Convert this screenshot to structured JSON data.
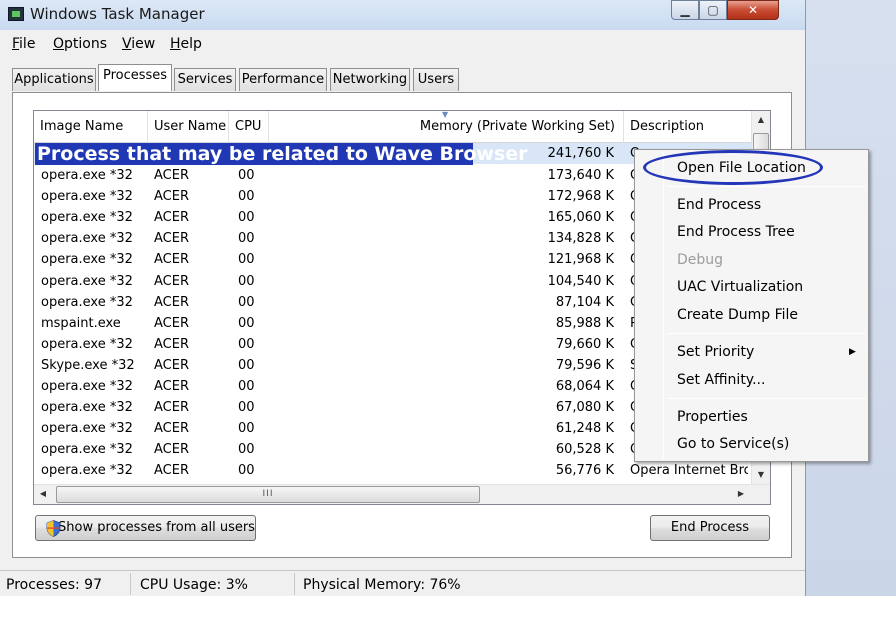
{
  "window": {
    "title": "Windows Task Manager",
    "controls": {
      "minimize": "▁",
      "maximize": "▢",
      "close": "✕"
    }
  },
  "menubar": [
    {
      "label": "File",
      "mnemonic": "F",
      "rest": "ile"
    },
    {
      "label": "Options",
      "mnemonic": "O",
      "rest": "ptions"
    },
    {
      "label": "View",
      "mnemonic": "V",
      "rest": "iew"
    },
    {
      "label": "Help",
      "mnemonic": "H",
      "rest": "elp"
    }
  ],
  "tabs": [
    "Applications",
    "Processes",
    "Services",
    "Performance",
    "Networking",
    "Users"
  ],
  "active_tab": "Processes",
  "columns": [
    "Image Name",
    "User Name",
    "CPU",
    "Memory (Private Working Set)",
    "Description"
  ],
  "callout_text": "Process that may be related to Wave Browser",
  "first_row_memory": "241,760 K",
  "first_row_desc": "O",
  "rows": [
    {
      "image": "opera.exe *32",
      "user": "ACER",
      "cpu": "00",
      "mem": "173,640 K",
      "desc": "O"
    },
    {
      "image": "opera.exe *32",
      "user": "ACER",
      "cpu": "00",
      "mem": "172,968 K",
      "desc": "O"
    },
    {
      "image": "opera.exe *32",
      "user": "ACER",
      "cpu": "00",
      "mem": "165,060 K",
      "desc": "O"
    },
    {
      "image": "opera.exe *32",
      "user": "ACER",
      "cpu": "00",
      "mem": "134,828 K",
      "desc": "O"
    },
    {
      "image": "opera.exe *32",
      "user": "ACER",
      "cpu": "00",
      "mem": "121,968 K",
      "desc": "O"
    },
    {
      "image": "opera.exe *32",
      "user": "ACER",
      "cpu": "00",
      "mem": "104,540 K",
      "desc": "O"
    },
    {
      "image": "opera.exe *32",
      "user": "ACER",
      "cpu": "00",
      "mem": "87,104 K",
      "desc": "O"
    },
    {
      "image": "mspaint.exe",
      "user": "ACER",
      "cpu": "00",
      "mem": "85,988 K",
      "desc": "P"
    },
    {
      "image": "opera.exe *32",
      "user": "ACER",
      "cpu": "00",
      "mem": "79,660 K",
      "desc": "O"
    },
    {
      "image": "Skype.exe *32",
      "user": "ACER",
      "cpu": "00",
      "mem": "79,596 K",
      "desc": "S"
    },
    {
      "image": "opera.exe *32",
      "user": "ACER",
      "cpu": "00",
      "mem": "68,064 K",
      "desc": "O"
    },
    {
      "image": "opera.exe *32",
      "user": "ACER",
      "cpu": "00",
      "mem": "67,080 K",
      "desc": "O"
    },
    {
      "image": "opera.exe *32",
      "user": "ACER",
      "cpu": "00",
      "mem": "61,248 K",
      "desc": "O"
    },
    {
      "image": "opera.exe *32",
      "user": "ACER",
      "cpu": "00",
      "mem": "60,528 K",
      "desc": "O"
    },
    {
      "image": "opera.exe *32",
      "user": "ACER",
      "cpu": "00",
      "mem": "56,776 K",
      "desc": "Opera Internet Brov"
    }
  ],
  "scroll_glyphs": {
    "up": "▲",
    "down": "▼",
    "left": "◀",
    "right": "▶",
    "grip": "III"
  },
  "buttons": {
    "show_all": "Show processes from all users",
    "end_process": "End Process"
  },
  "status": {
    "processes": "Processes: 97",
    "cpu": "CPU Usage: 3%",
    "memory": "Physical Memory: 76%"
  },
  "context_menu": [
    {
      "label": "Open File Location",
      "enabled": true,
      "highlighted_with_oval": true
    },
    {
      "label": "End Process",
      "enabled": true
    },
    {
      "label": "End Process Tree",
      "enabled": true
    },
    {
      "label": "Debug",
      "enabled": false
    },
    {
      "label": "UAC Virtualization",
      "enabled": true
    },
    {
      "label": "Create Dump File",
      "enabled": true
    },
    {
      "label": "Set Priority",
      "enabled": true,
      "submenu": true
    },
    {
      "label": "Set Affinity...",
      "enabled": true
    },
    {
      "label": "Properties",
      "enabled": true
    },
    {
      "label": "Go to Service(s)",
      "enabled": true
    }
  ],
  "submenu_arrow": "▶",
  "colors": {
    "callout_bg": "#2038b4",
    "oval_stroke": "#2436b8",
    "disabled_text": "#9c9c9c"
  }
}
